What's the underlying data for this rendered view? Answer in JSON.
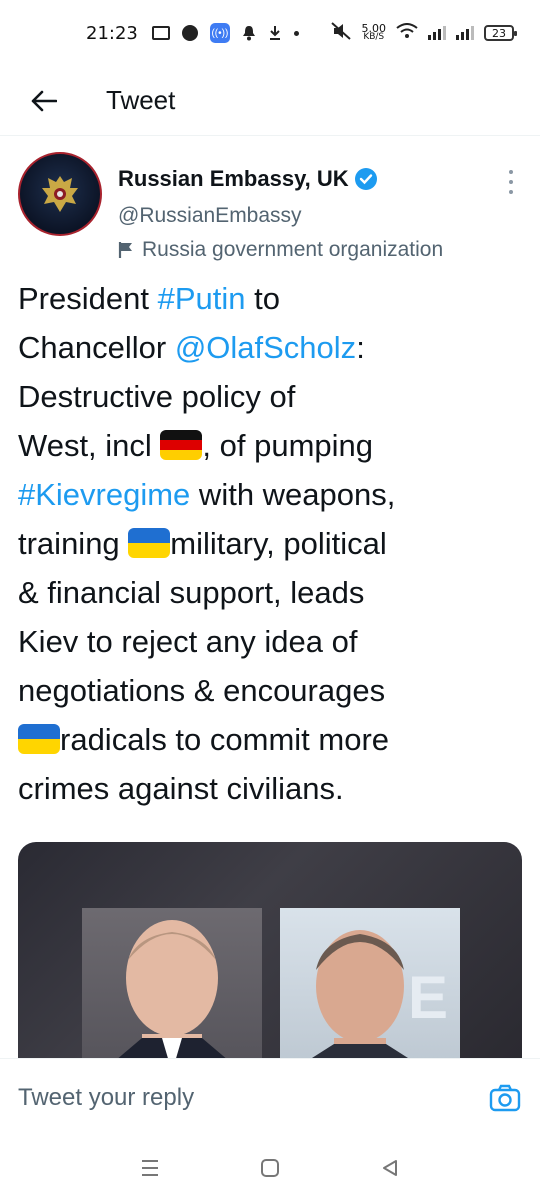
{
  "status_bar": {
    "time": "21:23",
    "net_speed_value": "5.00",
    "net_speed_unit": "KB/S",
    "battery": "23"
  },
  "header": {
    "title": "Tweet"
  },
  "tweet": {
    "author_name": "Russian Embassy, UK",
    "handle": "@RussianEmbassy",
    "label": "Russia government organization",
    "text_segments": {
      "l1a": "President ",
      "l1b": "#Putin",
      "l1c": " to",
      "l2a": "Chancellor ",
      "l2b": "@OlafScholz",
      "l2c": ":",
      "l3": "Destructive policy of",
      "l4a": "West, incl ",
      "l4b": ", of pumping",
      "l5a": "#Kievregime",
      "l5b": " with weapons,",
      "l6a": "training ",
      "l6b": "military, political",
      "l7": "& financial support, leads",
      "l8": "Kiev to reject any idea of",
      "l9": "negotiations & encourages",
      "l10": "radicals to commit more",
      "l11": "crimes against civilians."
    }
  },
  "reply": {
    "placeholder": "Tweet your reply"
  },
  "colors": {
    "link": "#1d9bf0",
    "text": "#0f1419",
    "secondary": "#536471"
  }
}
